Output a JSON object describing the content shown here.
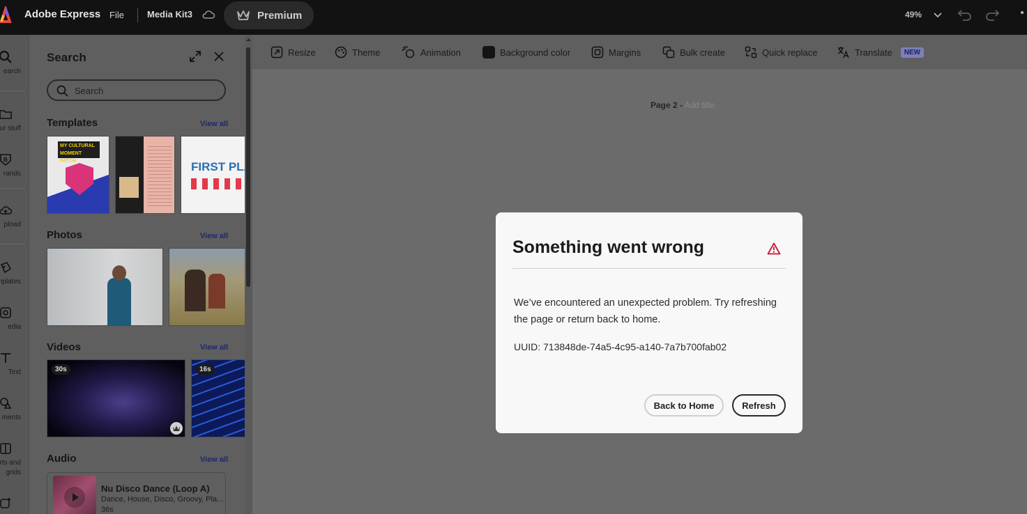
{
  "topbar": {
    "app_title": "Adobe Express",
    "file_label": "File",
    "doc_name": "Media Kit3",
    "premium_label": "Premium",
    "zoom": "49%"
  },
  "rail": {
    "items": [
      {
        "label": "earch"
      },
      {
        "label": "ur stuff"
      },
      {
        "label": "rands"
      },
      {
        "label": "pload"
      },
      {
        "label": "mplates"
      },
      {
        "label": "edia"
      },
      {
        "label": "Text"
      },
      {
        "label": "ments"
      },
      {
        "label": "rts and\ngrids"
      }
    ]
  },
  "panel": {
    "title": "Search",
    "search_placeholder": "Search",
    "templates": {
      "title": "Templates",
      "view_all": "View all"
    },
    "photos": {
      "title": "Photos",
      "view_all": "View all"
    },
    "videos": {
      "title": "Videos",
      "view_all": "View all",
      "durations": [
        "30s",
        "16s"
      ]
    },
    "audio": {
      "title": "Audio",
      "view_all": "View all",
      "track": {
        "title": "Nu Disco Dance (Loop A)",
        "genres": "Dance, House, Disco, Groovy, Pla...",
        "duration": "36s"
      }
    },
    "template_texts": {
      "t1_line1": "MY CULTURAL",
      "t1_line2": "MOMENT PATCH",
      "t3": "FIRST PLACE PO"
    }
  },
  "toolbar": {
    "items": [
      {
        "label": "Resize",
        "icon": "resize-icon"
      },
      {
        "label": "Theme",
        "icon": "palette-icon"
      },
      {
        "label": "Animation",
        "icon": "animation-icon"
      },
      {
        "label": "Background color",
        "icon": "color-swatch-icon"
      },
      {
        "label": "Margins",
        "icon": "margins-icon"
      },
      {
        "label": "Bulk create",
        "icon": "bulk-create-icon"
      },
      {
        "label": "Quick replace",
        "icon": "quick-replace-icon"
      },
      {
        "label": "Translate",
        "icon": "translate-icon"
      }
    ],
    "new_badge": "NEW"
  },
  "canvas": {
    "page_number": "Page 2 -",
    "add_title": "Add title"
  },
  "dialog": {
    "title": "Something went wrong",
    "message": "We’ve encountered an unexpected problem. Try refreshing the page or return back to home.",
    "uuid": "UUID: 713848de-74a5-4c95-a140-7a7b700fab02",
    "back_label": "Back to Home",
    "refresh_label": "Refresh"
  },
  "colors": {
    "topbar": "#121212",
    "overlay": "#6b6b6b",
    "dialog_bg": "#f8f8f8",
    "alert": "#c8102e",
    "link": "#1d2a6b"
  }
}
